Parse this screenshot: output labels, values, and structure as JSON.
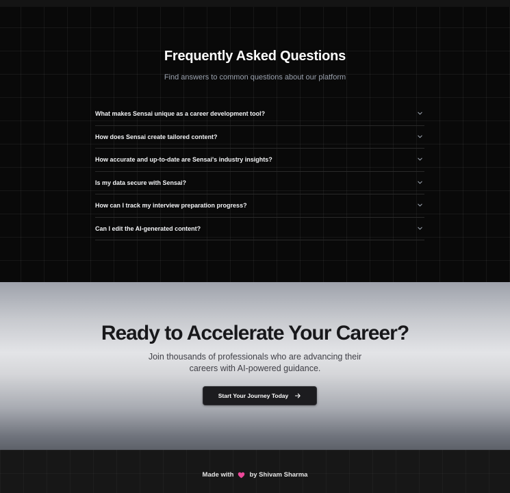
{
  "faq": {
    "title": "Frequently Asked Questions",
    "subtitle": "Find answers to common questions about our platform",
    "items": [
      {
        "question": "What makes Sensai unique as a career development tool?"
      },
      {
        "question": "How does Sensai create tailored content?"
      },
      {
        "question": "How accurate and up-to-date are Sensai's industry insights?"
      },
      {
        "question": "Is my data secure with Sensai?"
      },
      {
        "question": "How can I track my interview preparation progress?"
      },
      {
        "question": "Can I edit the AI-generated content?"
      }
    ],
    "chevron_icon": "chevron-down-icon"
  },
  "cta": {
    "title": "Ready to Accelerate Your Career?",
    "line1": "Join thousands of professionals who are advancing their",
    "line2": "careers with AI-powered guidance.",
    "button_label": "Start Your Journey Today",
    "button_icon": "arrow-right-icon"
  },
  "footer": {
    "made_with": "Made with",
    "heart_icon": "heart-icon",
    "heart_color": "#ec4899",
    "by_author": "by Shivam Sharma"
  }
}
